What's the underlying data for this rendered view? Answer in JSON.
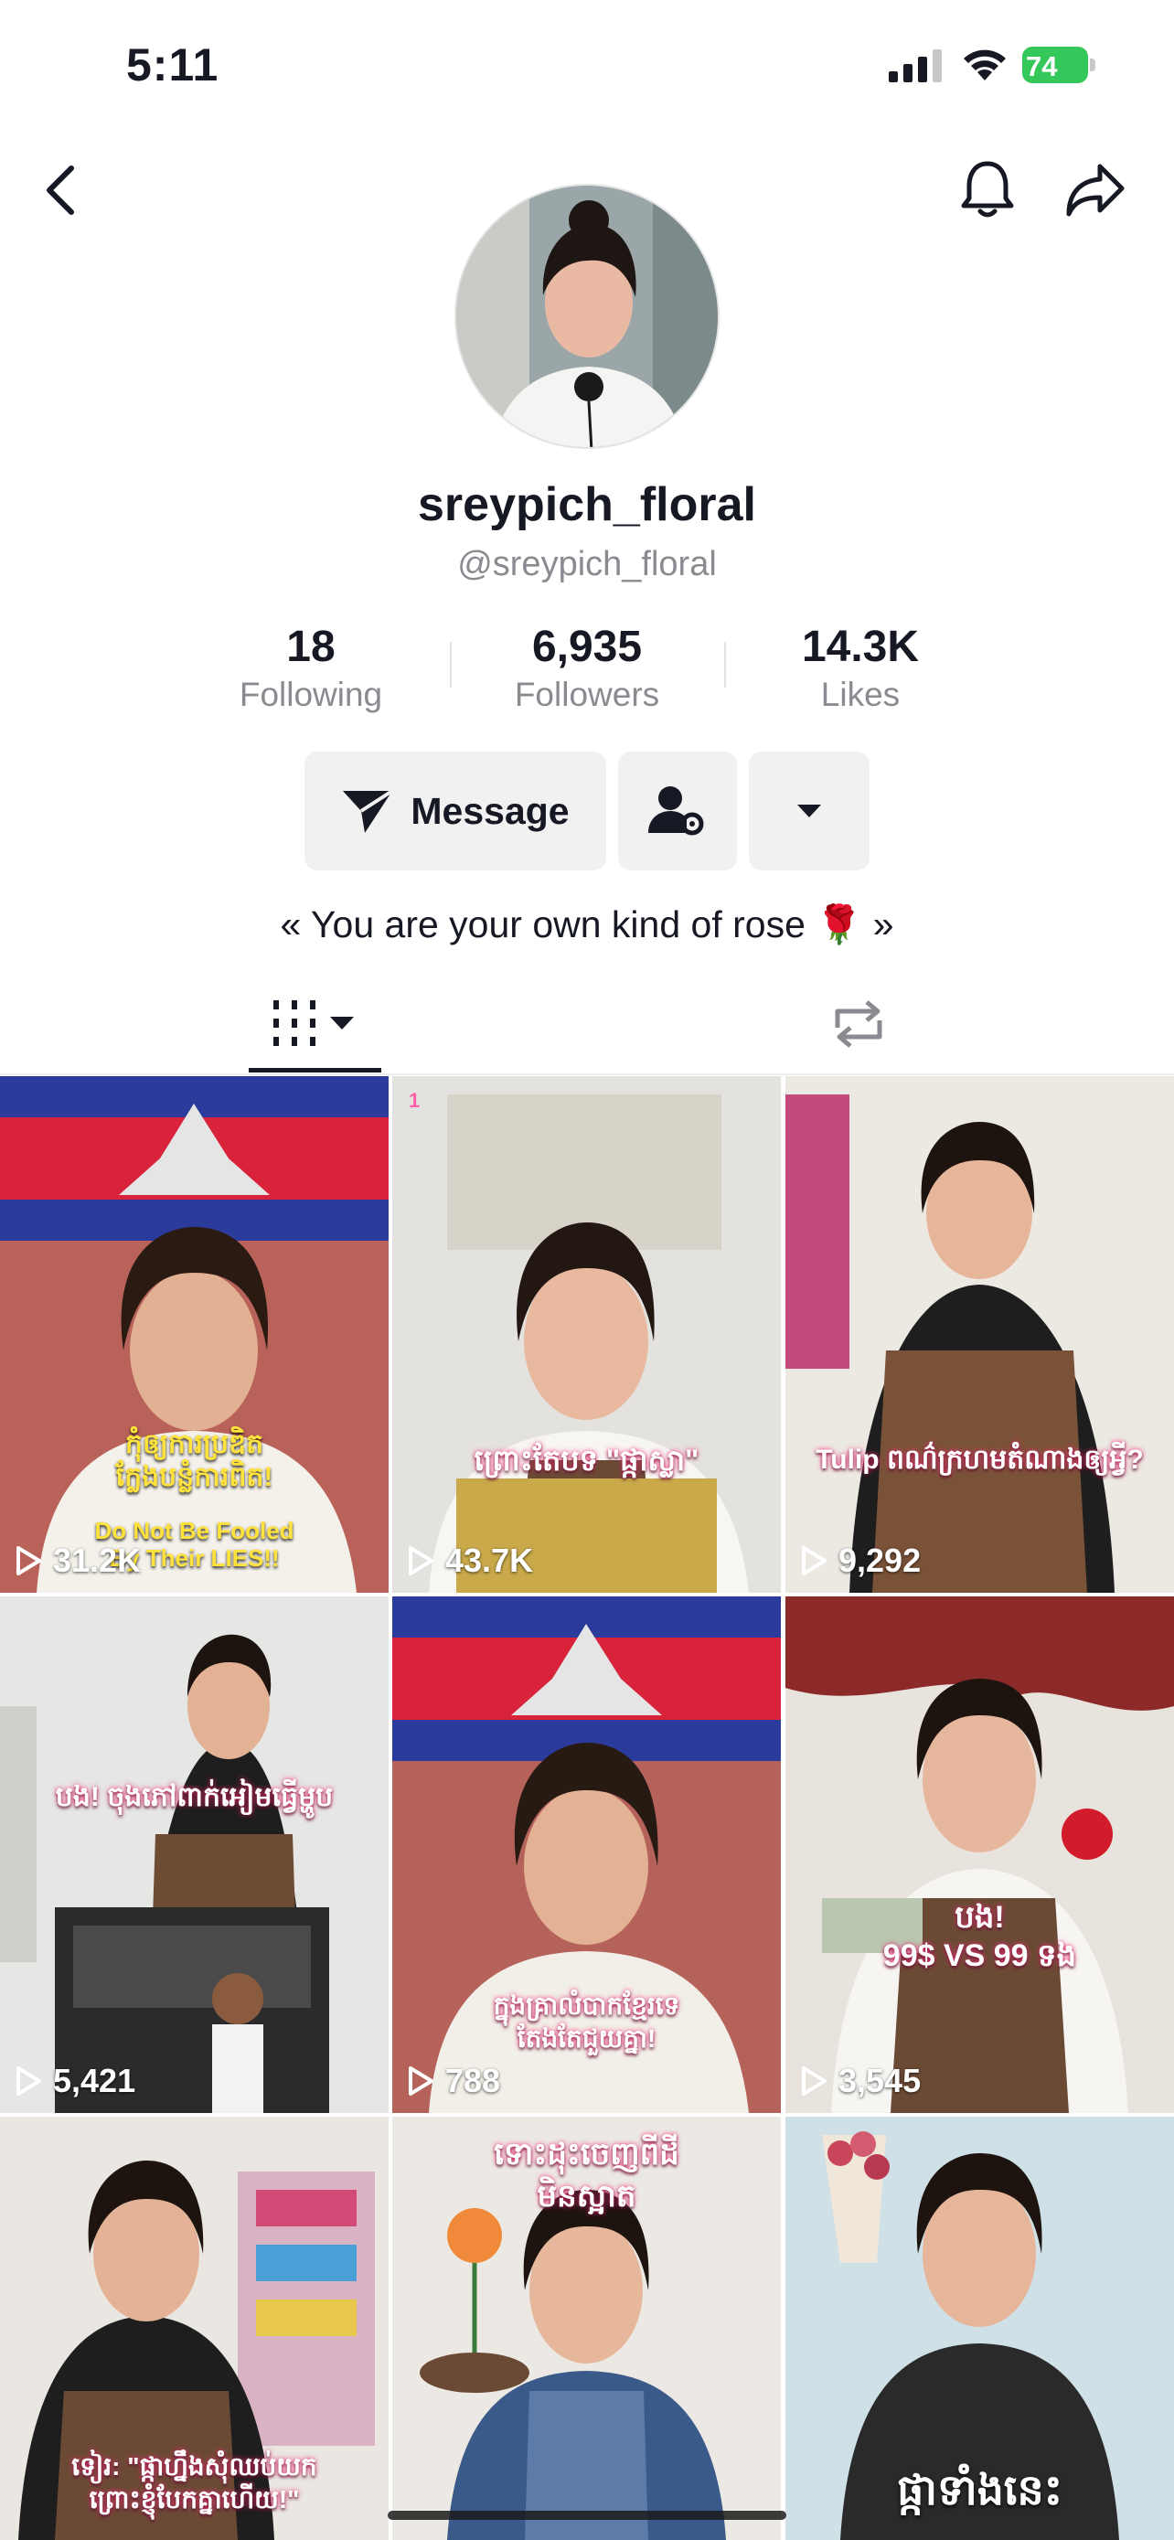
{
  "status_bar": {
    "time": "5:11",
    "battery": "74"
  },
  "profile": {
    "display_name": "sreypich_floral",
    "handle": "@sreypich_floral",
    "bio": "« You are your own kind of rose 🌹 »"
  },
  "stats": [
    {
      "value": "18",
      "label": "Following"
    },
    {
      "value": "6,935",
      "label": "Followers"
    },
    {
      "value": "14.3K",
      "label": "Likes"
    }
  ],
  "actions": {
    "message_label": "Message"
  },
  "colors": {
    "text": "#161823",
    "muted": "#8a8b91",
    "button_bg": "#f1f1f2",
    "battery_green": "#34c759",
    "caption_pink": "#ff2b7a"
  },
  "icons": [
    "back-icon",
    "bell-icon",
    "share-icon",
    "send-icon",
    "add-friend-icon",
    "dropdown-icon",
    "grid-icon",
    "repost-icon",
    "play-icon"
  ],
  "videos": [
    {
      "views": "31.2K",
      "caption": "កុំឲ្យការប្រឌិត\nក្លែងបន្លំការពិត!",
      "subcaption": "Do Not Be Fooled\nBy Their LIES!!",
      "pinned": ""
    },
    {
      "views": "43.7K",
      "caption": "ព្រោះតែបទ \"ផ្កាស្លា\"",
      "subcaption": "",
      "pinned": "1"
    },
    {
      "views": "9,292",
      "caption": "Tulip ពណ៌ក្រហមតំណាងឲ្យអ្វី?",
      "subcaption": "",
      "pinned": ""
    },
    {
      "views": "5,421",
      "caption": "បង! ចុងភៅពាក់អៀមធ្វើម្ហូប",
      "subcaption": "",
      "pinned": ""
    },
    {
      "views": "788",
      "caption": "ក្នុងគ្រាលំបាកខ្មែរទេ\nតែងតែជួយគ្នា!",
      "subcaption": "",
      "pinned": ""
    },
    {
      "views": "3,545",
      "caption": "បង!\n99$ VS 99 ទង",
      "subcaption": "",
      "pinned": ""
    },
    {
      "views": "",
      "caption": "ទៀរ: \"ផ្កាហ្នឹងសុំឈប់យក\nព្រោះខ្ញុំបែកគ្នាហើយ!\"",
      "subcaption": "",
      "pinned": ""
    },
    {
      "views": "",
      "caption": "ទោះដុះចេញពីដី\nមិនស្អាត",
      "subcaption": "",
      "pinned": ""
    },
    {
      "views": "",
      "caption": "ផ្កាទាំងនេះ",
      "subcaption": "",
      "pinned": ""
    }
  ]
}
